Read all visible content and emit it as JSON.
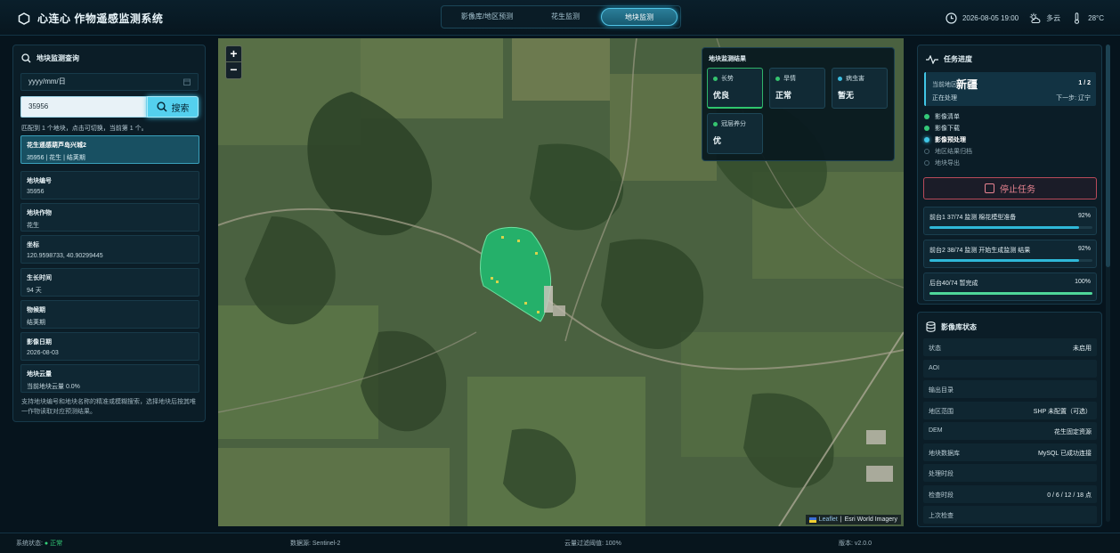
{
  "app": {
    "title": "心连心 作物遥感监测系统"
  },
  "tabs": [
    {
      "label": "影像库/地区预测"
    },
    {
      "label": "花生监测"
    },
    {
      "label": "地块监测"
    }
  ],
  "header": {
    "datetime": "2026-08-05 19:00",
    "weather": "多云",
    "temperature": "28°C"
  },
  "left_panel": {
    "title": "地块监测查询",
    "date_placeholder": "yyyy/mm/日",
    "search_value": "35956",
    "search_button": "搜索",
    "match_text": "匹配到 1 个地块，点击可切换，当前第 1 个。",
    "result": {
      "title": "花生遥感葫芦岛兴城2",
      "subtitle": "35956 | 花生 | 结荚期"
    },
    "fields": [
      {
        "label": "地块编号",
        "value": "35956"
      },
      {
        "label": "地块作物",
        "value": "花生"
      },
      {
        "label": "坐标",
        "value": "120.9598733, 40.90299445"
      },
      {
        "label": "生长时间",
        "value": "94 天"
      },
      {
        "label": "物候期",
        "value": "结荚期"
      },
      {
        "label": "影像日期",
        "value": "2026-08-03"
      },
      {
        "label": "地块云量",
        "value": "当前地块云量 0.0%"
      }
    ],
    "help_text": "支持地块编号和地块名称的精准或模糊搜索，选择地块后按其唯一作物读取对应预测结果。"
  },
  "map": {
    "zoom_in": "+",
    "zoom_out": "−",
    "attribution_link": "Leaflet",
    "attribution_sep": "|",
    "attribution_source": "Esri World Imagery",
    "results": {
      "title": "地块监测结果",
      "cards": [
        {
          "label": "长势",
          "value": "优良",
          "dot": "#35c46f"
        },
        {
          "label": "旱情",
          "value": "正常",
          "dot": "#35c46f"
        },
        {
          "label": "病虫害",
          "value": "暂无",
          "dot": "#3bbbe0"
        },
        {
          "label": "冠层养分",
          "value": "优",
          "dot": "#35c46f"
        }
      ]
    }
  },
  "task_panel": {
    "title": "任务进度",
    "region_label": "当前地区",
    "region_name": "新疆",
    "count": "1 / 2",
    "status": "正在处理",
    "next": "下一步: 辽宁",
    "steps": [
      {
        "label": "影像清单",
        "state": "done"
      },
      {
        "label": "影像下载",
        "state": "done"
      },
      {
        "label": "影像预处理",
        "state": "active"
      },
      {
        "label": "地区结果归档",
        "state": "pending"
      },
      {
        "label": "地块导出",
        "state": "pending"
      }
    ],
    "stop_button": "停止任务",
    "progress": [
      {
        "label": "前台1 37/74 监测 棉花模型准备",
        "percent_text": "92%",
        "percent": 92,
        "color": "#2fb8d8"
      },
      {
        "label": "前台2 38/74 监测 开始生成监测 结果",
        "percent_text": "92%",
        "percent": 92,
        "color": "#2fb8d8"
      },
      {
        "label": "后台40/74 暂完成",
        "percent_text": "100%",
        "percent": 100,
        "color": "#4fd89a"
      }
    ]
  },
  "db_panel": {
    "title": "影像库状态",
    "rows": [
      {
        "key": "状态",
        "value": "未启用"
      },
      {
        "key": "AOI",
        "value": ""
      },
      {
        "key": "输出目录",
        "value": ""
      },
      {
        "key": "地区范围",
        "value": "SHP 未配置（可选）"
      },
      {
        "key": "DEM",
        "value": "花生固定资源"
      },
      {
        "key": "地块数据库",
        "value": "MySQL 已成功连接"
      },
      {
        "key": "处理时段",
        "value": ""
      },
      {
        "key": "检查时段",
        "value": "0 / 6 / 12 / 18 点"
      },
      {
        "key": "上次检查",
        "value": ""
      }
    ]
  },
  "footer": {
    "status_label": "系统状态:",
    "status_value": "● 正常",
    "source": "数据源: Sentinel-2",
    "cloud": "云量过滤阈值: 100%",
    "version_label": "版本:",
    "version_value": "v2.0.0"
  },
  "colors": {
    "accent": "#3fc6e6",
    "ok": "#34d27a",
    "danger": "#e98391"
  }
}
